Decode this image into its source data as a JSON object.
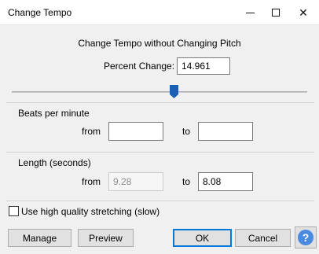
{
  "window": {
    "title": "Change Tempo",
    "minimize_glyph": "",
    "maximize_glyph": "",
    "close_glyph": "✕"
  },
  "dialog": {
    "heading": "Change Tempo without Changing Pitch",
    "percent_change": {
      "label": "Percent Change:",
      "value": "14.961"
    },
    "slider": {
      "level_fraction": 0.55
    },
    "bpm": {
      "group_title": "Beats per minute",
      "from_label": "from",
      "from_value": "",
      "to_label": "to",
      "to_value": ""
    },
    "length": {
      "group_title": "Length (seconds)",
      "from_label": "from",
      "from_value": "9.28",
      "to_label": "to",
      "to_value": "8.08"
    },
    "high_quality": {
      "label": "Use high quality stretching (slow)",
      "checked": false
    },
    "buttons": {
      "manage": "Manage",
      "preview": "Preview",
      "ok": "OK",
      "cancel": "Cancel",
      "help_glyph": "?"
    }
  },
  "colors": {
    "accent": "#0078d7",
    "slider_thumb": "#1a5fb4",
    "help_icon": "#4a8be0",
    "dialog_bg": "#f0f0f0"
  }
}
